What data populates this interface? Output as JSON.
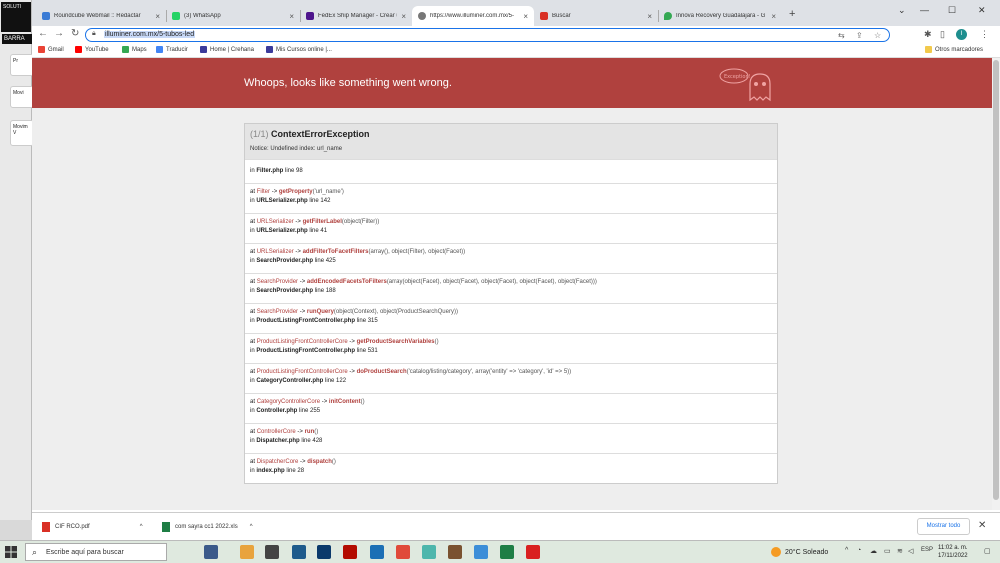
{
  "left_app": {
    "logo_text": "SOLUTI",
    "barra": "BARRA",
    "buttons": [
      "Pr",
      "Movi",
      "Movim V"
    ]
  },
  "tabs": [
    {
      "title": "Roundcube Webmail :: Redactar",
      "color": "#3a7bd5"
    },
    {
      "title": "(3) WhatsApp",
      "color": "#25d366"
    },
    {
      "title": "FedEx Ship Manager - Crear un e",
      "color": "#4d148c"
    },
    {
      "title": "https://www.illuminer.com.mx/5-",
      "color": "#777777"
    },
    {
      "title": "Buscar",
      "color": "#d93025"
    },
    {
      "title": "Innova Recovery Guadalajara - G",
      "color": "#34a853"
    }
  ],
  "address_bar": {
    "url": "illuminer.com.mx/5-tubos-led"
  },
  "bookmarks": [
    {
      "label": "Gmail",
      "color": "#ea4335"
    },
    {
      "label": "YouTube",
      "color": "#ff0000"
    },
    {
      "label": "Maps",
      "color": "#34a853"
    },
    {
      "label": "Traducir",
      "color": "#4285f4"
    },
    {
      "label": "Home | Crehana",
      "color": "#3b3b9b"
    },
    {
      "label": "Mis Cursos online |...",
      "color": "#3b3b9b"
    }
  ],
  "other_bookmarks": "Otros marcadores",
  "error": {
    "header_message": "Whoops, looks like something went wrong.",
    "count": "(1/1)",
    "exception_name": "ContextErrorException",
    "notice": "Notice: Undefined index: url_name",
    "header_color": "#b0413e"
  },
  "trace": [
    {
      "file": "Filter.php",
      "line": "98"
    },
    {
      "class": "Filter",
      "method": "getProperty",
      "args": "('url_name')",
      "file": "URLSerializer.php",
      "line": "142"
    },
    {
      "class": "URLSerializer",
      "method": "getFilterLabel",
      "args": "(object(Filter))",
      "file": "URLSerializer.php",
      "line": "41"
    },
    {
      "class": "URLSerializer",
      "method": "addFilterToFacetFilters",
      "args": "(array(), object(Filter), object(Facet))",
      "file": "SearchProvider.php",
      "line": "425"
    },
    {
      "class": "SearchProvider",
      "method": "addEncodedFacetsToFilters",
      "args": "(array(object(Facet), object(Facet), object(Facet), object(Facet), object(Facet)))",
      "file": "SearchProvider.php",
      "line": "188"
    },
    {
      "class": "SearchProvider",
      "method": "runQuery",
      "args": "(object(Context), object(ProductSearchQuery))",
      "file": "ProductListingFrontController.php",
      "line": "315"
    },
    {
      "class": "ProductListingFrontControllerCore",
      "method": "getProductSearchVariables",
      "args": "()",
      "file": "ProductListingFrontController.php",
      "line": "531"
    },
    {
      "class": "ProductListingFrontControllerCore",
      "method": "doProductSearch",
      "args": "('catalog/listing/category', array('entity' => 'category', 'id' => 5))",
      "file": "CategoryController.php",
      "line": "122"
    },
    {
      "class": "CategoryControllerCore",
      "method": "initContent",
      "args": "()",
      "file": "Controller.php",
      "line": "255"
    },
    {
      "class": "ControllerCore",
      "method": "run",
      "args": "()",
      "file": "Dispatcher.php",
      "line": "428"
    },
    {
      "class": "DispatcherCore",
      "method": "dispatch",
      "args": "()",
      "file": "index.php",
      "line": "28"
    }
  ],
  "trace_labels": {
    "at": "at",
    "in": "in",
    "line": "line",
    "arrow": "->"
  },
  "downloads": [
    {
      "name": "CIF RCO.pdf",
      "color": "#d93025"
    },
    {
      "name": "com sayra cc1 2022.xls",
      "color": "#1e7e45"
    }
  ],
  "show_all": "Mostrar todo",
  "taskbar": {
    "search_placeholder": "Escribe aquí para buscar",
    "apps": [
      "#3b5a8a",
      "#e8a33d",
      "#444444",
      "#1e5b8c",
      "#0a3a6b",
      "#b30b00",
      "#1b6fb5",
      "#e04a3a",
      "#4db6ac",
      "#7a5230",
      "#3c8ed8",
      "#1e7e45",
      "#d92020"
    ],
    "weather": "20°C  Soleado",
    "lang": "ESP",
    "time": "11:02 a. m.",
    "date": "17/11/2022"
  }
}
